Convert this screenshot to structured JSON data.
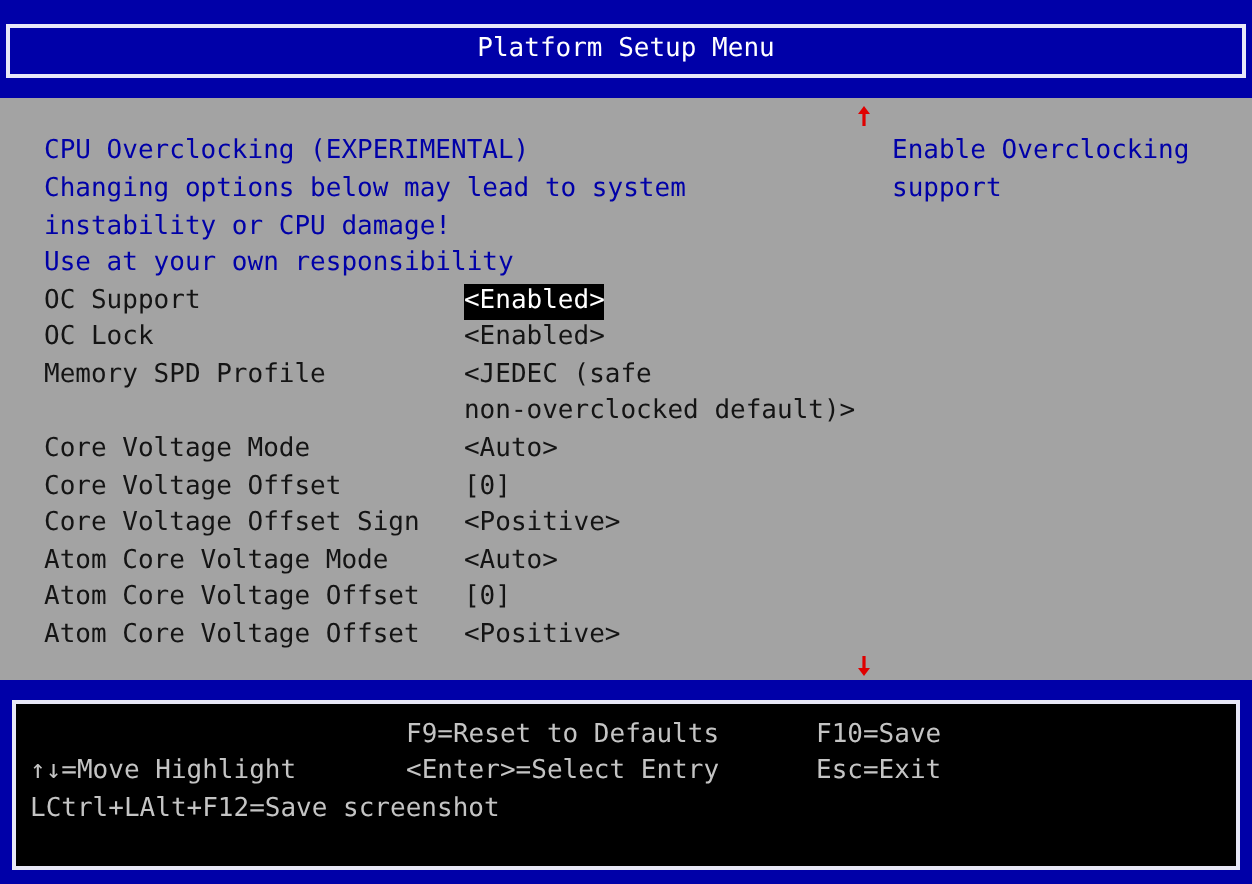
{
  "header": {
    "title": "Platform Setup Menu"
  },
  "info_lines": [
    "CPU Overclocking (EXPERIMENTAL)",
    "Changing options below may lead to system",
    "instability or CPU damage!",
    "Use at your own responsibility"
  ],
  "settings": [
    {
      "label": "OC Support",
      "value": "<Enabled>",
      "selected": true
    },
    {
      "label": "OC Lock",
      "value": "<Enabled>",
      "selected": false
    },
    {
      "label": "Memory SPD Profile",
      "value_lines": [
        "<JEDEC (safe",
        "non-overclocked default)>"
      ],
      "selected": false
    },
    {
      "label": "Core Voltage Mode",
      "value": "<Auto>",
      "selected": false
    },
    {
      "label": "Core Voltage Offset",
      "value": "[0]",
      "selected": false
    },
    {
      "label": "Core Voltage Offset Sign",
      "value": "<Positive>",
      "selected": false
    },
    {
      "label": "Atom Core Voltage Mode",
      "value": "<Auto>",
      "selected": false
    },
    {
      "label": "Atom Core Voltage Offset",
      "value": "[0]",
      "selected": false
    },
    {
      "label": "Atom Core Voltage Offset",
      "value": "<Positive>",
      "selected": false
    }
  ],
  "help": {
    "text": "Enable Overclocking support"
  },
  "footer": {
    "rows": [
      [
        null,
        "F9=Reset to Defaults",
        "F10=Save"
      ],
      [
        "↑↓=Move Highlight",
        "<Enter>=Select Entry",
        "Esc=Exit"
      ],
      [
        "LCtrl+LAlt+F12=Save screenshot",
        null,
        null
      ]
    ]
  }
}
